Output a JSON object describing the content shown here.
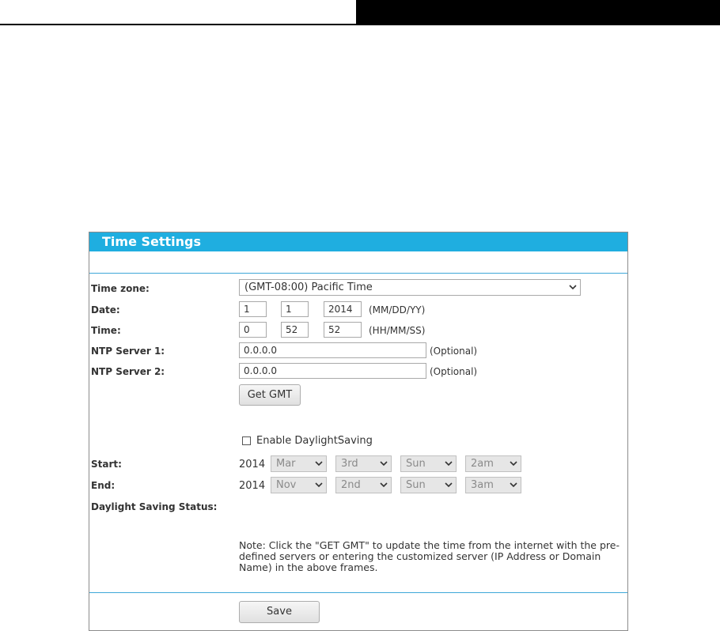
{
  "panel": {
    "title": "Time Settings"
  },
  "form": {
    "timezone": {
      "label": "Time zone:",
      "value": "(GMT-08:00) Pacific Time"
    },
    "date": {
      "label": "Date:",
      "month": "1",
      "day": "1",
      "year": "2014",
      "hint": "(MM/DD/YY)"
    },
    "time": {
      "label": "Time:",
      "hour": "0",
      "minute": "52",
      "second": "52",
      "hint": "(HH/MM/SS)"
    },
    "ntp1": {
      "label": "NTP Server 1:",
      "value": "0.0.0.0",
      "hint": "(Optional)"
    },
    "ntp2": {
      "label": "NTP Server 2:",
      "value": "0.0.0.0",
      "hint": "(Optional)"
    },
    "get_gmt_label": "Get GMT",
    "dst_enable_label": "Enable DaylightSaving",
    "dst_enabled": false,
    "start": {
      "label": "Start:",
      "year": "2014",
      "month": "Mar",
      "week": "3rd",
      "day": "Sun",
      "hour": "2am"
    },
    "end": {
      "label": "End:",
      "year": "2014",
      "month": "Nov",
      "week": "2nd",
      "day": "Sun",
      "hour": "3am"
    },
    "dst_status_label": "Daylight Saving Status:",
    "note": "Note: Click the \"GET GMT\" to update the time from the internet with the pre-defined servers or entering the customized server (IP Address or Domain Name) in the above frames.",
    "save_label": "Save"
  },
  "colors": {
    "title_bar": "#1faee0",
    "separator": "#3ea7d8"
  }
}
